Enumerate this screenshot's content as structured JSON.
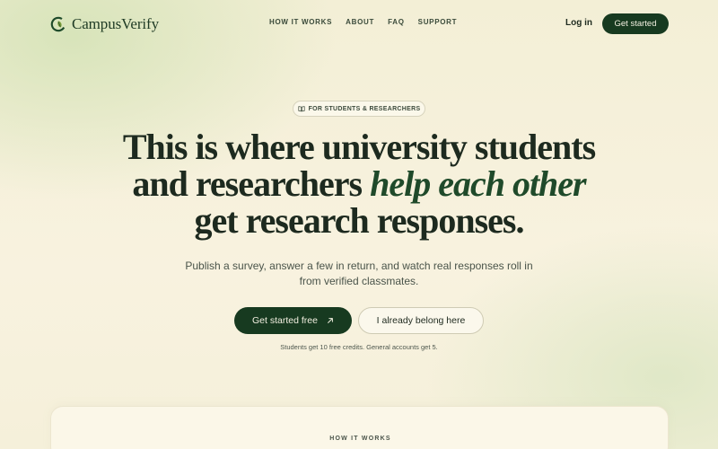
{
  "brand": {
    "name": "CampusVerify"
  },
  "nav": {
    "items": [
      {
        "label": "HOW IT WORKS"
      },
      {
        "label": "ABOUT"
      },
      {
        "label": "FAQ"
      },
      {
        "label": "SUPPORT"
      }
    ],
    "login": "Log in",
    "get_started": "Get started"
  },
  "hero": {
    "badge": "FOR STUDENTS & RESEARCHERS",
    "headline": {
      "line1": "This is where university students",
      "line2_a": "and researchers ",
      "line2_em": "help each other",
      "line3": "get research responses."
    },
    "subtitle": "Publish a survey, answer a few in return, and watch real responses roll in from verified classmates.",
    "cta_primary": "Get started free",
    "cta_secondary": "I already belong here",
    "note": "Students get 10 free credits. General accounts get 5."
  },
  "section": {
    "label": "HOW IT WORKS"
  },
  "colors": {
    "accent": "#173a20",
    "background": "#f7f1de",
    "text": "#1f2a1f"
  },
  "icons": {
    "logo": "leaf-logo-icon",
    "badge": "book-icon",
    "cta": "arrow-up-right-icon"
  }
}
